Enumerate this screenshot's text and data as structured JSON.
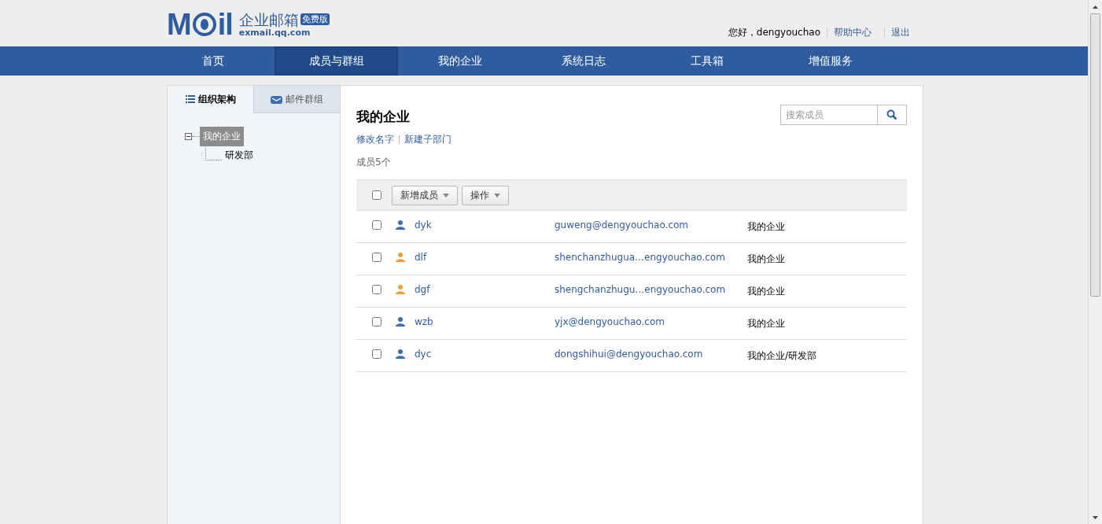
{
  "logo": {
    "mark_left": "M",
    "mark_right": "il",
    "name": "企业邮箱",
    "badge": "免费版",
    "domain": "exmail.qq.com"
  },
  "user_bar": {
    "greeting": "您好，dengyouchao",
    "links": [
      "帮助中心",
      "退出"
    ]
  },
  "nav": [
    {
      "label": "首页",
      "selected": false
    },
    {
      "label": "成员与群组",
      "selected": true
    },
    {
      "label": "我的企业",
      "selected": false
    },
    {
      "label": "系统日志",
      "selected": false
    },
    {
      "label": "工具箱",
      "selected": false
    },
    {
      "label": "增值服务",
      "selected": false
    }
  ],
  "sidebar": {
    "tabs": [
      {
        "label": "组织架构",
        "selected": true,
        "kind": "list"
      },
      {
        "label": "邮件群组",
        "selected": false,
        "kind": "mail"
      }
    ],
    "tree": [
      {
        "label": "我的企业",
        "selected": true,
        "expanded": true,
        "children": [
          {
            "label": "研发部",
            "selected": false
          }
        ]
      }
    ]
  },
  "main": {
    "title": "我的企业",
    "actions": [
      "修改名字",
      "新建子部门"
    ],
    "member_count": "成员5个",
    "search": {
      "placeholder": "搜索成员"
    },
    "toolbar": {
      "select_all": {
        "checked": false
      },
      "buttons": [
        "新增成员",
        "操作"
      ]
    },
    "members": [
      {
        "name": "dyk",
        "email": "guweng@dengyouchao.com",
        "department": "我的企业",
        "checked": false,
        "color": "#3b6fb2"
      },
      {
        "name": "dlf",
        "email": "shenchanzhugua…engyouchao.com",
        "department": "我的企业",
        "checked": false,
        "color": "#f0a040"
      },
      {
        "name": "dgf",
        "email": "shengchanzhugu…engyouchao.com",
        "department": "我的企业",
        "checked": false,
        "color": "#f0a040"
      },
      {
        "name": "wzb",
        "email": "yjx@dengyouchao.com",
        "department": "我的企业",
        "checked": false,
        "color": "#3b6fb2"
      },
      {
        "name": "dyc",
        "email": "dongshihui@dengyouchao.com",
        "department": "我的企业/研发部",
        "checked": false,
        "color": "#3b6fb2"
      }
    ]
  }
}
